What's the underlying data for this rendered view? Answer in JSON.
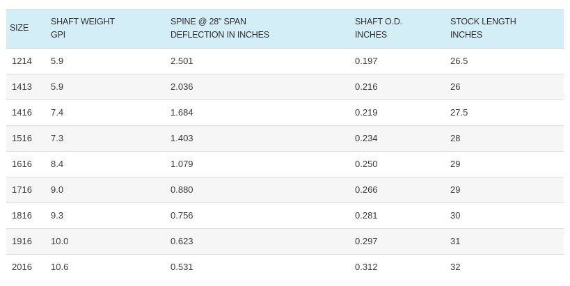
{
  "table": {
    "headers": [
      {
        "line1": "SIZE",
        "line2": ""
      },
      {
        "line1": "SHAFT WEIGHT",
        "line2": "GPI"
      },
      {
        "line1": "SPINE @ 28\" SPAN",
        "line2": "DEFLECTION IN INCHES"
      },
      {
        "line1": "SHAFT O.D.",
        "line2": "INCHES"
      },
      {
        "line1": "STOCK LENGTH",
        "line2": "INCHES"
      }
    ],
    "rows": [
      [
        "1214",
        "5.9",
        "2.501",
        "0.197",
        "26.5"
      ],
      [
        "1413",
        "5.9",
        "2.036",
        "0.216",
        "26"
      ],
      [
        "1416",
        "7.4",
        "1.684",
        "0.219",
        "27.5"
      ],
      [
        "1516",
        "7.3",
        "1.403",
        "0.234",
        "28"
      ],
      [
        "1616",
        "8.4",
        "1.079",
        "0.250",
        "29"
      ],
      [
        "1716",
        "9.0",
        "0.880",
        "0.266",
        "29"
      ],
      [
        "1816",
        "9.3",
        "0.756",
        "0.281",
        "30"
      ],
      [
        "1916",
        "10.0",
        "0.623",
        "0.297",
        "31"
      ],
      [
        "2016",
        "10.6",
        "0.531",
        "0.312",
        "32"
      ]
    ]
  },
  "colors": {
    "header_bg": "#d4eef8",
    "row_alt_bg": "#f6f6f6",
    "border": "#dcdcdc"
  }
}
